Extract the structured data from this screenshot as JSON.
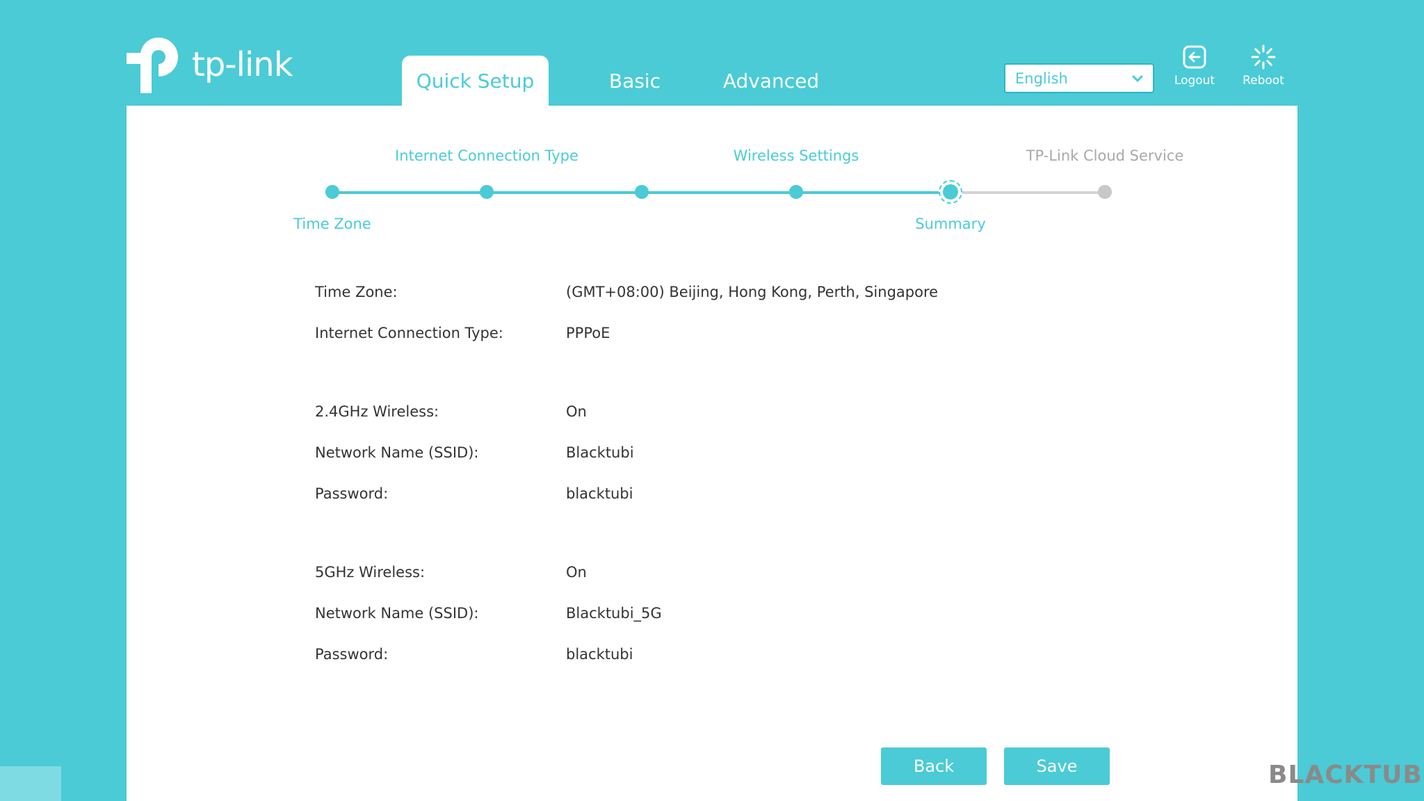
{
  "brand": {
    "logo_text": "tp-link",
    "color": "#4acbd6"
  },
  "tabs": [
    {
      "label": "Quick Setup",
      "active": true
    },
    {
      "label": "Basic",
      "active": false
    },
    {
      "label": "Advanced",
      "active": false
    }
  ],
  "header": {
    "language": "English",
    "logout_label": "Logout",
    "reboot_label": "Reboot"
  },
  "steps": [
    {
      "label": "Time Zone",
      "state": "done"
    },
    {
      "label": "Internet Connection Type",
      "state": "done"
    },
    {
      "label": "",
      "state": "done"
    },
    {
      "label": "Wireless Settings",
      "state": "done"
    },
    {
      "label": "Summary",
      "state": "current"
    },
    {
      "label": "TP-Link Cloud Service",
      "state": "pending"
    }
  ],
  "summary": [
    {
      "label": "Time Zone:",
      "value": "(GMT+08:00) Beijing, Hong Kong, Perth, Singapore"
    },
    {
      "label": "Internet Connection Type:",
      "value": "PPPoE"
    },
    {
      "label": "2.4GHz Wireless:",
      "value": "On"
    },
    {
      "label": "Network Name (SSID):",
      "value": "Blacktubi"
    },
    {
      "label": "Password:",
      "value": "blacktubi"
    },
    {
      "label": "5GHz Wireless:",
      "value": "On"
    },
    {
      "label": "Network Name (SSID):",
      "value": "Blacktubi_5G"
    },
    {
      "label": "Password:",
      "value": "blacktubi"
    }
  ],
  "buttons": {
    "back_label": "Back",
    "save_label": "Save"
  },
  "watermark": "BLACKTUBI"
}
